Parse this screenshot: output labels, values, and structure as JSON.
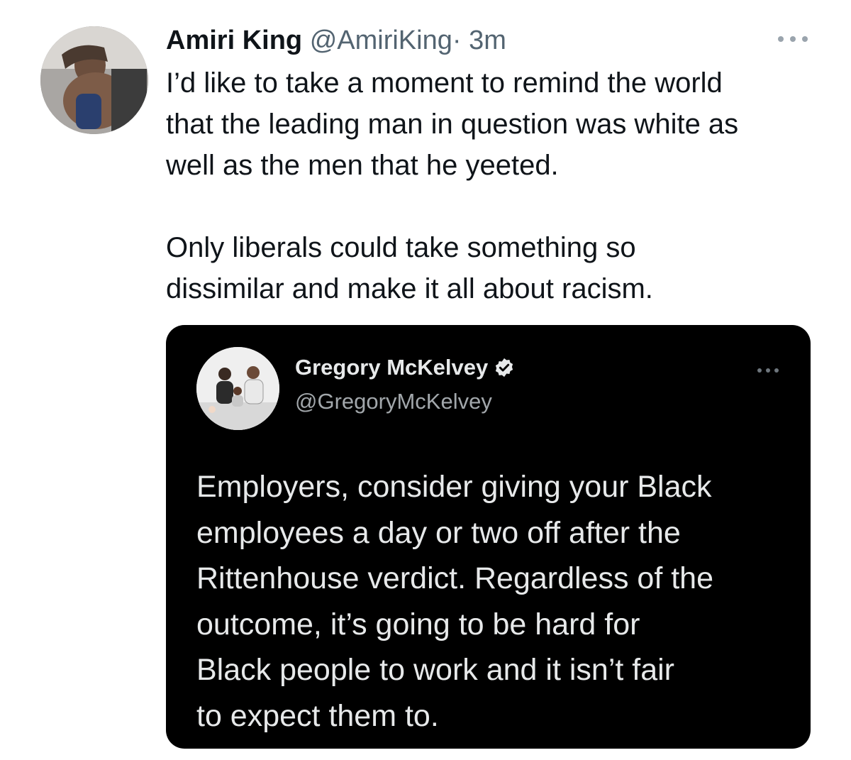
{
  "tweet": {
    "author_name": "Amiri King",
    "author_handle": "@AmiriKing",
    "separator": "·",
    "time": "3m",
    "avatar_icon": "user-avatar-photo",
    "more_icon": "more-options-icon",
    "lines": [
      "I’d like to take a moment to remind the world",
      "that the leading man in question was white as",
      "well as the men that he yeeted.",
      "Only liberals could take something so",
      "dissimilar and make it all about racism."
    ]
  },
  "quoted_tweet": {
    "author_name": "Gregory McKelvey",
    "author_handle": "@GregoryMcKelvey",
    "verified": true,
    "verified_icon": "verified-badge-icon",
    "avatar_icon": "user-avatar-photo",
    "more_icon": "more-options-icon",
    "background": "#000000",
    "lines": [
      "Employers, consider giving your Black",
      "employees a day or two off after the",
      "Rittenhouse verdict. Regardless of the",
      "outcome, it’s going to be hard for",
      "Black people to work and it isn’t fair",
      "to expect them to."
    ]
  },
  "colors": {
    "text_primary": "#0f1419",
    "text_secondary": "#536471",
    "quote_text": "#e7e9ea",
    "quote_secondary": "#a2a7ab"
  }
}
